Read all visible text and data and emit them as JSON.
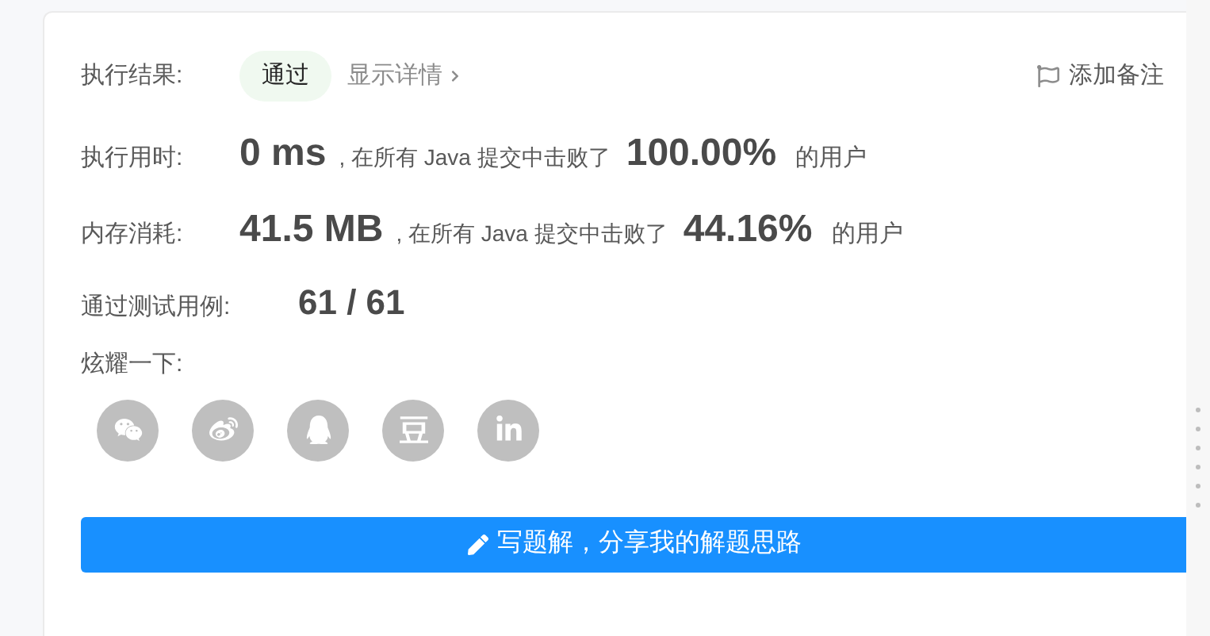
{
  "result": {
    "label": "执行结果:",
    "status": "通过",
    "details_link": "显示详情",
    "note_button": "添加备注"
  },
  "stats": [
    {
      "label": "执行用时:",
      "value": "0 ms",
      "text": ", 在所有 Java 提交中击败了",
      "percent": "100.00%",
      "suffix": "的用户"
    },
    {
      "label": "内存消耗:",
      "value": "41.5 MB",
      "text": ", 在所有 Java 提交中击败了",
      "percent": "44.16%",
      "suffix": "的用户"
    }
  ],
  "test_cases": {
    "label": "通过测试用例:",
    "value": "61 / 61"
  },
  "share": {
    "label": "炫耀一下:"
  },
  "write_button": "写题解，分享我的解题思路"
}
